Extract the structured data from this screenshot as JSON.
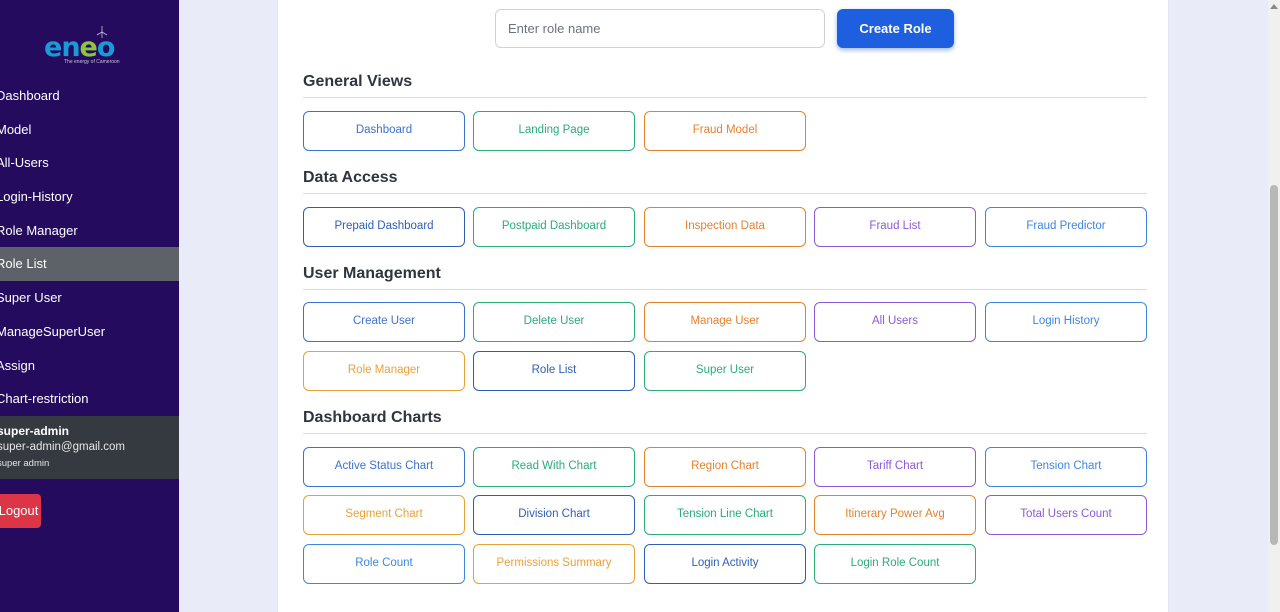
{
  "sidebar": {
    "logo": {
      "text": "eneo",
      "tagline": "The energy of Cameroon"
    },
    "nav": [
      {
        "label": "Dashboard"
      },
      {
        "label": "Model"
      },
      {
        "label": "All-Users"
      },
      {
        "label": "Login-History"
      },
      {
        "label": "Role Manager"
      },
      {
        "label": "Role List",
        "active": true
      },
      {
        "label": "Super User"
      },
      {
        "label": "ManageSuperUser"
      },
      {
        "label": "Assign"
      },
      {
        "label": "Chart-restriction"
      }
    ],
    "user": {
      "name": "super-admin",
      "email": "super-admin@gmail.com",
      "role": "super admin"
    },
    "logout_label": "Logout"
  },
  "create": {
    "placeholder": "Enter role name",
    "button_label": "Create Role"
  },
  "sections": [
    {
      "title": "General Views",
      "permissions": [
        "Dashboard",
        "Landing Page",
        "Fraud Model"
      ]
    },
    {
      "title": "Data Access",
      "permissions": [
        "Prepaid Dashboard",
        "Postpaid Dashboard",
        "Inspection Data",
        "Fraud List",
        "Fraud Predictor"
      ]
    },
    {
      "title": "User Management",
      "permissions": [
        "Create User",
        "Delete User",
        "Manage User",
        "All Users",
        "Login History",
        "Role Manager",
        "Role List",
        "Super User"
      ]
    },
    {
      "title": "Dashboard Charts",
      "permissions": [
        "Active Status Chart",
        "Read With Chart",
        "Region Chart",
        "Tariff Chart",
        "Tension Chart",
        "Segment Chart",
        "Division Chart",
        "Tension Line Chart",
        "Itinerary Power Avg",
        "Total Users Count",
        "Role Count",
        "Permissions Summary",
        "Login Activity",
        "Login Role Count"
      ]
    }
  ],
  "colors": {
    "sidebar_bg": "#240b5e",
    "primary": "#1d5fdf",
    "logout": "#dc3545"
  }
}
